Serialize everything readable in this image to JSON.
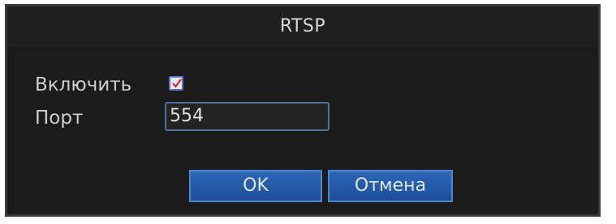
{
  "dialog": {
    "title": "RTSP"
  },
  "form": {
    "enable_label": "Включить",
    "enable_checked": true,
    "port_label": "Порт",
    "port_value": "554"
  },
  "buttons": {
    "ok_label": "OK",
    "cancel_label": "Отмена"
  },
  "colors": {
    "dialog_background": "#1b1b1b",
    "button_fill": "#2d67b8",
    "checkmark": "#d11a1a"
  },
  "icons": {
    "checkbox_mark": "checkmark-icon"
  }
}
